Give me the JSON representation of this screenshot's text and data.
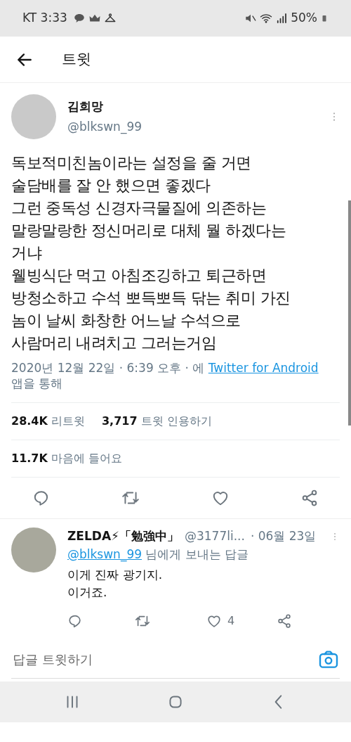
{
  "status_bar": {
    "carrier_time": "KT 3:33",
    "battery": "50%"
  },
  "header": {
    "title": "트윗"
  },
  "tweet": {
    "author": {
      "name": "김희망",
      "handle": "@blkswn_99"
    },
    "text": "독보적미친놈이라는 설정을 줄 거면\n술담배를 잘 안 했으면 좋겠다\n그런 중독성 신경자극물질에 의존하는\n말랑말랑한 정신머리로 대체 뭘 하겠다는\n거냐\n웰빙식단 먹고 아침조깅하고 퇴근하면\n방청소하고 수석 뽀득뽀득 닦는 취미 가진\n놈이 날씨 화창한 어느날 수석으로\n사람머리 내려치고 그러는거임",
    "timestamp": "2020년 12월 22일 · 6:39 오후 · 에",
    "source": "Twitter for Android",
    "source_suffix": "앱을 통해",
    "stats": [
      {
        "count": "28.4K",
        "label": "리트윗"
      },
      {
        "count": "3,717",
        "label": "트윗 인용하기"
      }
    ],
    "likes": {
      "count": "11.7K",
      "label": "마음에 들어요"
    }
  },
  "reply": {
    "name": "ZELDA⚡「勉強中」",
    "handle": "@3177li...",
    "date": "· 06월 23일",
    "reply_to": "@blkswn_99",
    "reply_to_suffix": "님에게 보내는 답글",
    "text": "이게 진짜 광기지.\n이거죠.",
    "like_count": "4"
  },
  "compose": {
    "placeholder": "답글 트윗하기"
  }
}
